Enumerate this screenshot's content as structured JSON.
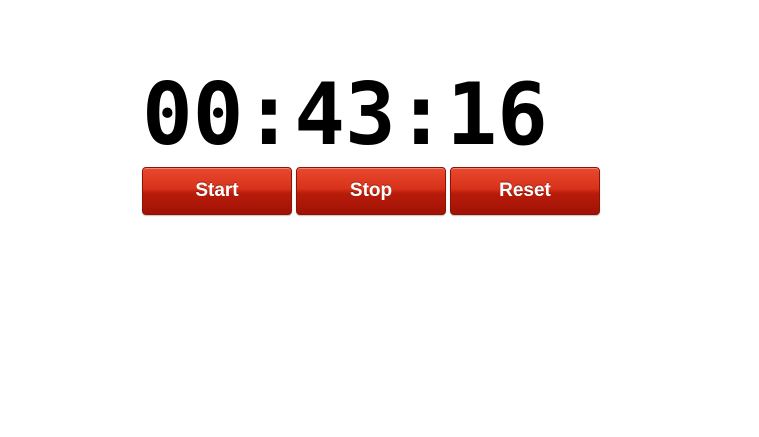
{
  "timer": {
    "display": "00:43:16"
  },
  "controls": {
    "start_label": "Start",
    "stop_label": "Stop",
    "reset_label": "Reset"
  },
  "colors": {
    "button_top": "#e8492f",
    "button_bottom": "#a01205",
    "digits": "#000000",
    "background": "#ffffff"
  }
}
